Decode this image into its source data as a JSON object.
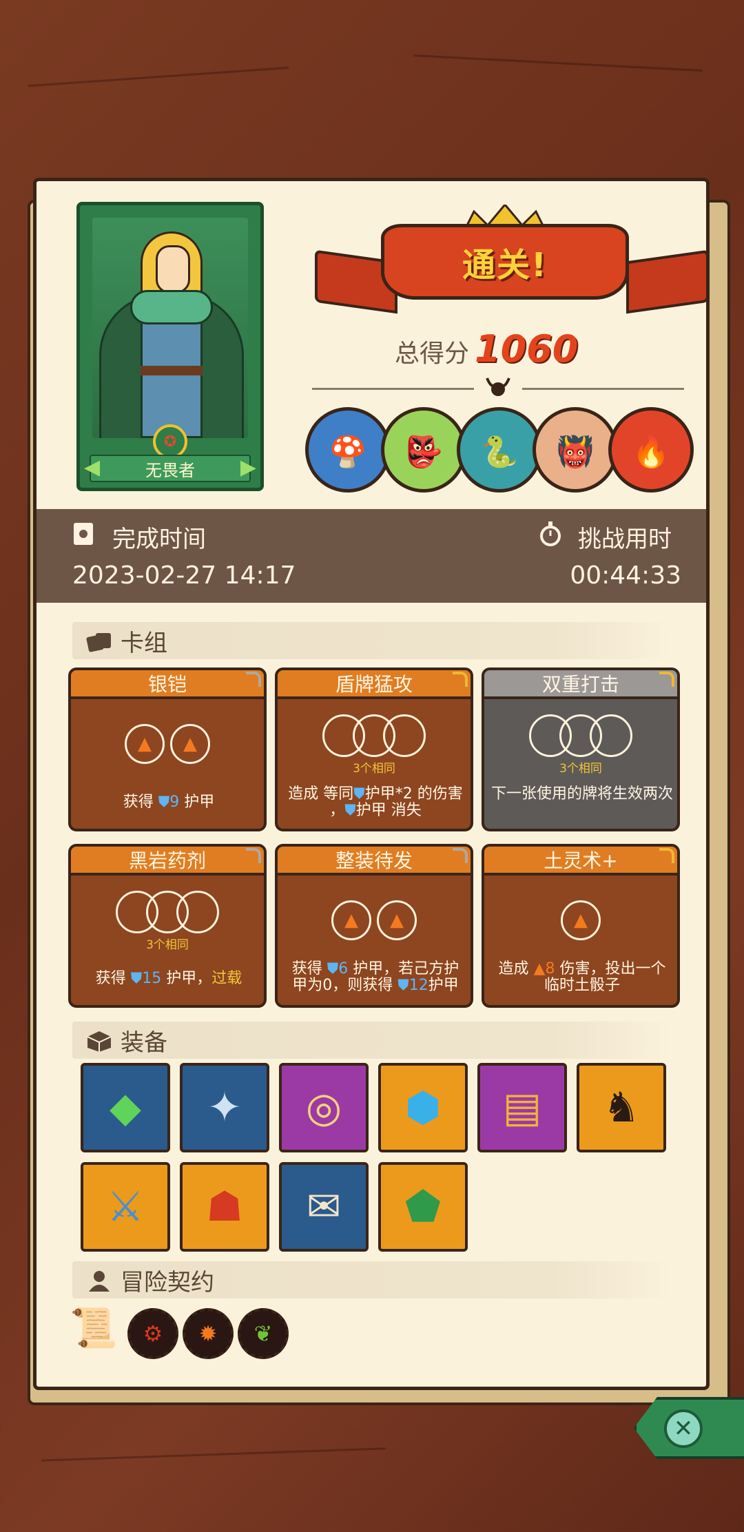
{
  "hero": {
    "title": "无畏者"
  },
  "banner": {
    "text": "通关!"
  },
  "score": {
    "label": "总得分",
    "value": "1060"
  },
  "bosses": [
    {
      "icon": "mushroom-elder-icon",
      "color": "#3f7fc7"
    },
    {
      "icon": "green-goblin-icon",
      "color": "#9ad35a"
    },
    {
      "icon": "serpent-icon",
      "color": "#3aa0a8"
    },
    {
      "icon": "tribal-mask-icon",
      "color": "#e9b08a"
    },
    {
      "icon": "fire-demon-icon",
      "color": "#e2442a"
    }
  ],
  "completion": {
    "finish_label": "完成时间",
    "finish_value": "2023-02-27 14:17",
    "duration_label": "挑战用时",
    "duration_value": "00:44:33"
  },
  "deck": {
    "title": "卡组",
    "cards": [
      {
        "name": "银铠",
        "style": "orange",
        "desc_pre": "获得 ",
        "shield": "9",
        "desc_post": " 护甲"
      },
      {
        "name": "盾牌猛攻",
        "style": "orange",
        "same": "3个相同",
        "line1": "造成 等同",
        "line1b": "护甲*2 的伤害",
        "line2": "，",
        "line2b": "护甲 消失"
      },
      {
        "name": "双重打击",
        "style": "gray",
        "same": "3个相同",
        "desc": "下一张使用的牌将生效两次"
      },
      {
        "name": "黑岩药剂",
        "style": "orange",
        "same": "3个相同",
        "desc_pre": "获得 ",
        "shield": "15",
        "desc_mid": " 护甲，",
        "highlight": "过载"
      },
      {
        "name": "整装待发",
        "style": "orange",
        "line1": "获得 ",
        "shield1": "6",
        "line1b": " 护甲，若己方护",
        "line2": "甲为0，则获得 ",
        "shield2": "12",
        "line2b": "护甲"
      },
      {
        "name": "土灵术+",
        "style": "orange",
        "line1": "造成 ",
        "damage": "8",
        "line1b": " 伤害，投出一个",
        "line2": "临时土骰子"
      }
    ]
  },
  "equipment": {
    "title": "装备",
    "items": [
      {
        "icon": "emerald-gem-icon",
        "color": "#2b5a8c",
        "glyph": "◆"
      },
      {
        "icon": "compass-star-icon",
        "color": "#2b5a8c",
        "glyph": "✦"
      },
      {
        "icon": "golden-mirror-icon",
        "color": "#9c3aa5",
        "glyph": "◎"
      },
      {
        "icon": "skull-shield-icon",
        "color": "#ec9a1c",
        "glyph": "⬢"
      },
      {
        "icon": "spellbook-icon",
        "color": "#9c3aa5",
        "glyph": "▤"
      },
      {
        "icon": "dark-armor-icon",
        "color": "#ec9a1c",
        "glyph": "♞"
      },
      {
        "icon": "serrated-blade-icon",
        "color": "#ec9a1c",
        "glyph": "⚔"
      },
      {
        "icon": "tribal-mask-icon",
        "color": "#ec9a1c",
        "glyph": "☗"
      },
      {
        "icon": "scroll-icon",
        "color": "#2b5a8c",
        "glyph": "✉"
      },
      {
        "icon": "green-ore-icon",
        "color": "#ec9a1c",
        "glyph": "⬟"
      }
    ]
  },
  "contract": {
    "title": "冒险契约",
    "items": [
      {
        "icon": "red-rune-icon",
        "glyph": "⚙",
        "color": "#d63a22"
      },
      {
        "icon": "fire-burst-icon",
        "glyph": "✹",
        "color": "#f57a1e"
      },
      {
        "icon": "green-leaf-icon",
        "glyph": "❦",
        "color": "#6fc23a"
      }
    ]
  }
}
